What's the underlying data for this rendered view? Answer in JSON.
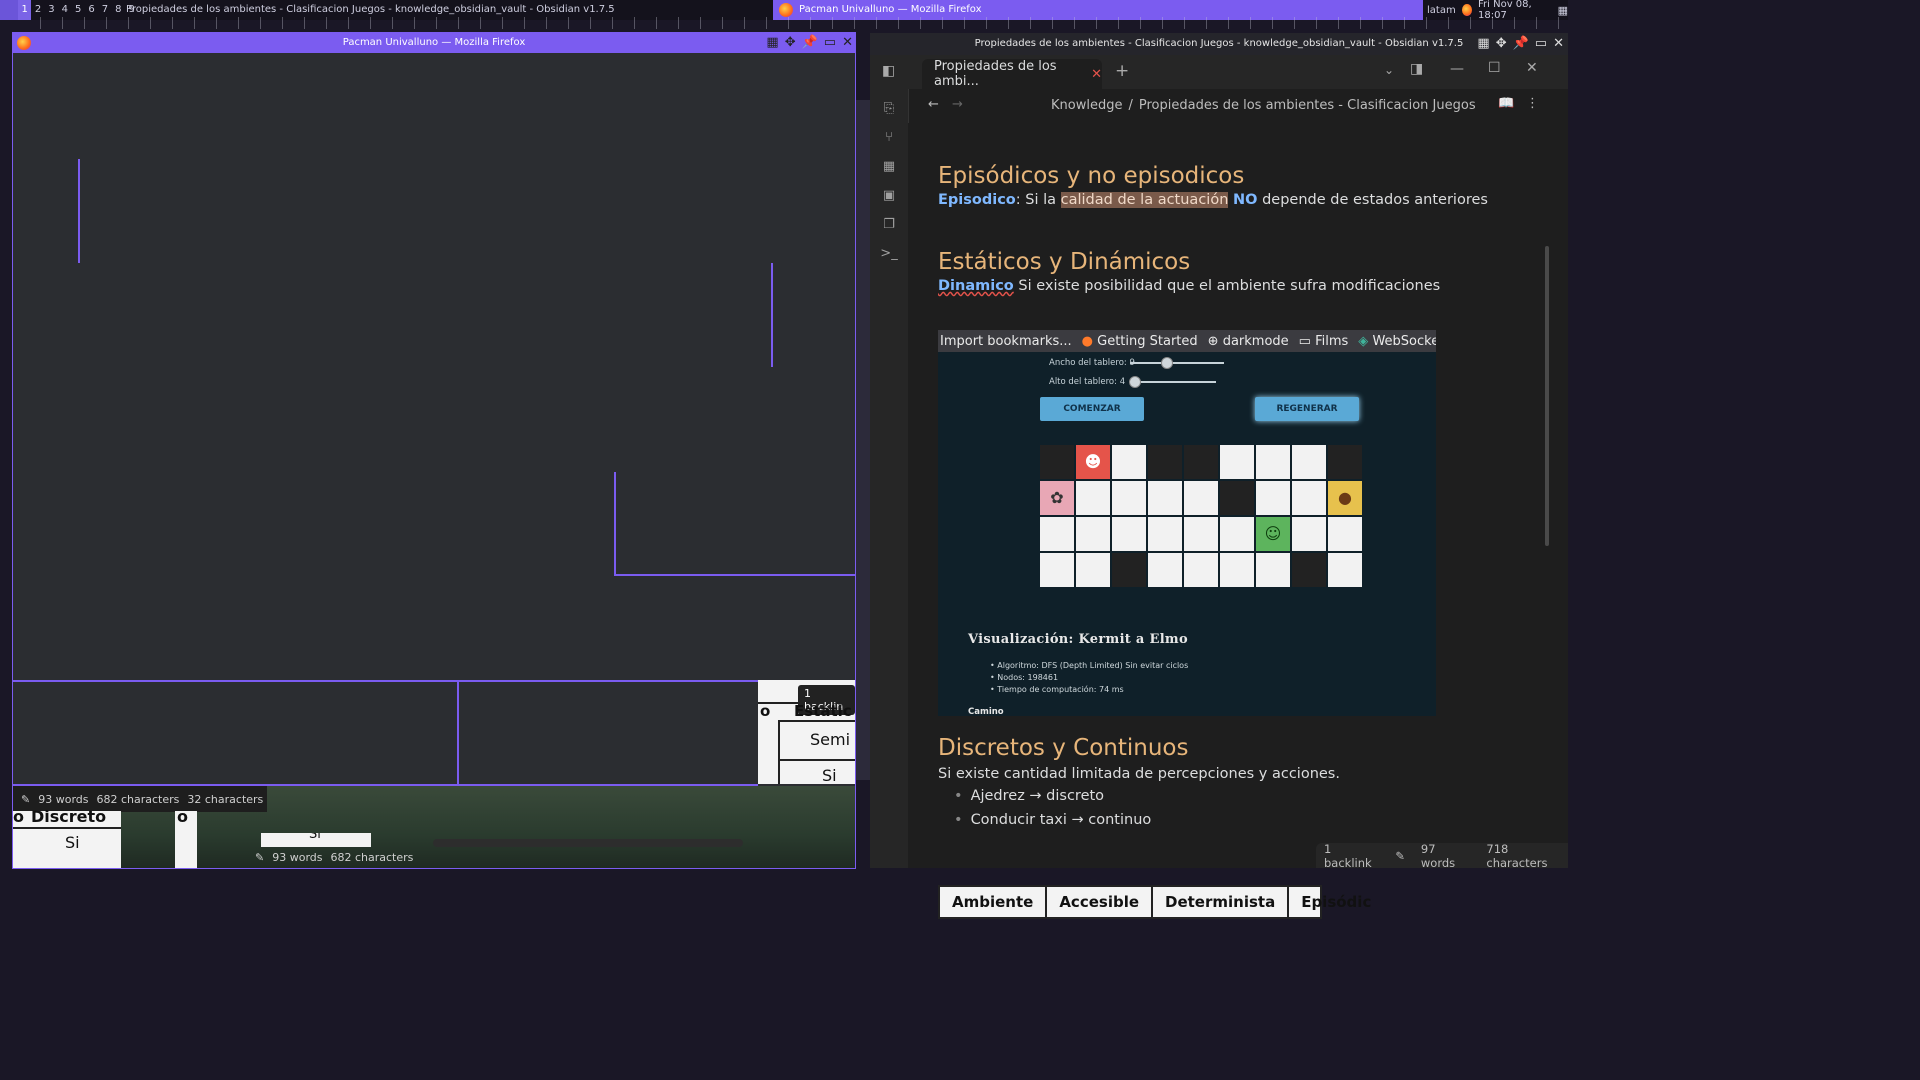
{
  "topbar": {
    "workspaces": [
      "1",
      "2",
      "3",
      "4",
      "5",
      "6",
      "7",
      "8",
      "9"
    ],
    "active_workspace": "1",
    "left_title": "Propiedades de los ambientes - Clasificacion Juegos - knowledge_obsidian_vault - Obsidian v1.7.5",
    "center_title": "Pacman Univalluno — Mozilla Firefox",
    "locale": "latam",
    "datetime": "Fri Nov 08, 18:07"
  },
  "firefox": {
    "title": "Pacman Univalluno — Mozilla Firefox",
    "status_words": "93 words",
    "status_chars": "682 characters",
    "status_chars_partial": "32 characters",
    "backlink_partial": "1 backlin",
    "bg_table": {
      "col_partial": "Estátic",
      "col_partial_left": "o",
      "row1": "Semi",
      "row2": "Si",
      "lower_header": "Discreto",
      "lower_header_left": "o",
      "lower_header_right": "o",
      "lower_row": "Si",
      "lower_row_partial": "Si"
    },
    "bottom_status_words": "93 words",
    "bottom_status_chars": "682 characters"
  },
  "obsidian": {
    "title": "Propiedades de los ambientes - Clasificacion Juegos - knowledge_obsidian_vault - Obsidian v1.7.5",
    "tab_label": "Propiedades de los ambi...",
    "breadcrumb": [
      "Knowledge",
      "/",
      "Propiedades de los ambientes - Clasificacion Juegos"
    ],
    "sections": {
      "episodic": {
        "heading": "Episódicos y no episodicos",
        "term": "Episodico",
        "text_a": ": Si la ",
        "highlight": "calidad de la actuación",
        "no": "NO",
        "text_b": " depende de estados anteriores"
      },
      "static": {
        "heading": "Estáticos y Dinámicos",
        "term": "Dinamico",
        "text": " Si existe posibilidad que el ambiente sufra modificaciones"
      },
      "discrete": {
        "heading": "Discretos y Continuos",
        "text": "Si existe cantidad limitada de percepciones y acciones.",
        "bullets": [
          "Ajedrez → discreto",
          "Conducir taxi → continuo"
        ]
      }
    },
    "embed": {
      "bookmarks": [
        "Import bookmarks...",
        "Getting Started",
        "darkmode",
        "Films",
        "WebSocket • H"
      ],
      "slider1_label": "Ancho del tablero: 9",
      "slider1_value": 0.45,
      "slider2_label": "Alto del tablero: 4",
      "slider2_value": 0.0,
      "btn_start": "COMENZAR",
      "btn_regen": "REGENERAR",
      "vis_title": "Visualización: Kermit a Elmo",
      "vis_items": [
        "Algoritmo: DFS (Depth Limited) Sin evitar ciclos",
        "Nodos: 198461",
        "Tiempo de computación: 74 ms"
      ],
      "camino_label": "Camino"
    },
    "table_headers": [
      "Ambiente",
      "Accesible",
      "Determinista",
      "Episódic"
    ],
    "status": {
      "backlinks": "1 backlink",
      "words": "97 words",
      "chars": "718 characters"
    }
  }
}
